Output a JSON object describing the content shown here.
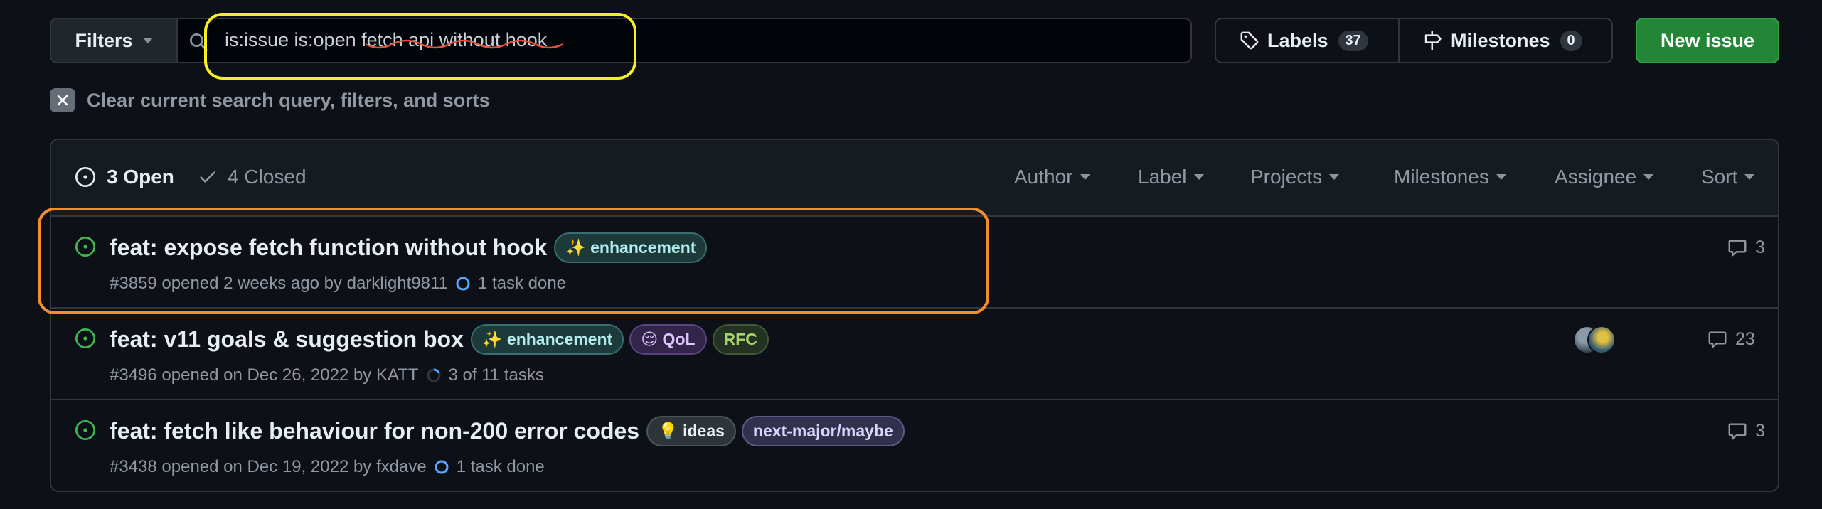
{
  "toolbar": {
    "filters_label": "Filters",
    "search_query": "is:issue is:open fetch api without hook",
    "labels_label": "Labels",
    "labels_count": "37",
    "milestones_label": "Milestones",
    "milestones_count": "0",
    "new_issue_label": "New issue"
  },
  "clear_query_label": "Clear current search query, filters, and sorts",
  "header": {
    "open_label": "3 Open",
    "closed_label": "4 Closed",
    "filters": [
      "Author",
      "Label",
      "Projects",
      "Milestones",
      "Assignee",
      "Sort"
    ]
  },
  "issues": [
    {
      "title": "feat: expose fetch function without hook",
      "labels": [
        "✨ enhancement"
      ],
      "meta": "#3859 opened 2 weeks ago by darklight9811",
      "tasks": "1 task done",
      "comments": "3"
    },
    {
      "title": "feat: v11 goals & suggestion box",
      "labels": [
        "✨ enhancement",
        "😌 QoL",
        "RFC"
      ],
      "meta": "#3496 opened on Dec 26, 2022 by KATT",
      "tasks": "3 of 11 tasks",
      "comments": "23"
    },
    {
      "title": "feat: fetch like behaviour for non-200 error codes",
      "labels": [
        "💡 ideas",
        "next-major/maybe"
      ],
      "meta": "#3438 opened on Dec 19, 2022 by fxdave",
      "tasks": "1 task done",
      "comments": "3"
    }
  ],
  "colors": {
    "background": "#0d1117",
    "primary_button": "#238636",
    "open_icon": "#3fb950",
    "highlight_yellow": "#f7f01f",
    "highlight_orange": "#f38c2a",
    "squiggle": "#e5533c"
  },
  "icons": [
    "search-icon",
    "tag-icon",
    "milestone-icon",
    "issue-open-icon",
    "check-icon",
    "comment-icon",
    "close-icon",
    "caret-down-icon"
  ]
}
